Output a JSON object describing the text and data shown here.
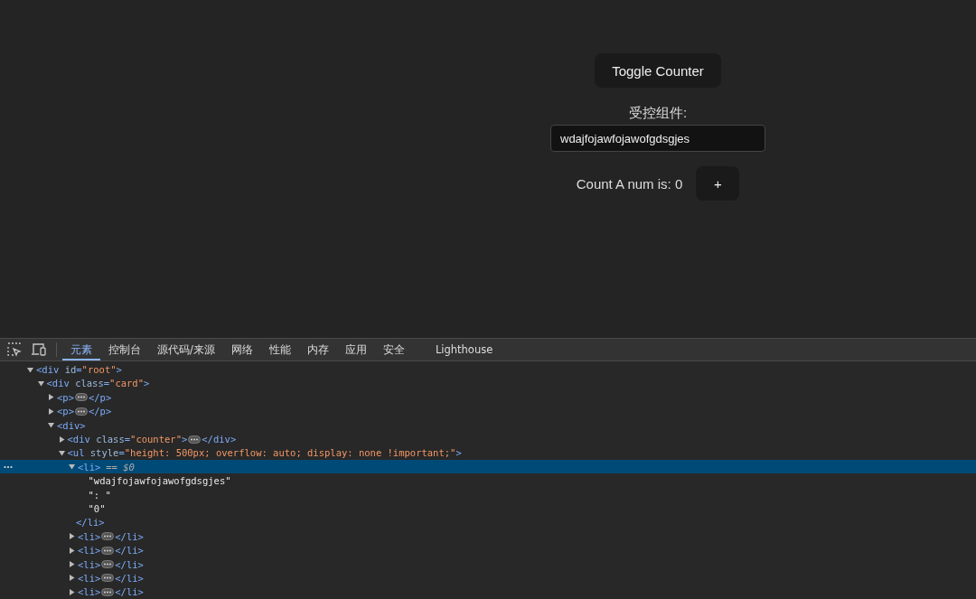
{
  "page": {
    "toggle_button": "Toggle Counter",
    "field_label": "受控组件:",
    "field_value": "wdajfojawfojawofgdsgjes",
    "counter_text": "Count A num is: 0",
    "increment_button": "+"
  },
  "devtools": {
    "tabs": [
      {
        "label": "元素",
        "selected": true
      },
      {
        "label": "控制台",
        "selected": false
      },
      {
        "label": "源代码/来源",
        "selected": false
      },
      {
        "label": "网络",
        "selected": false
      },
      {
        "label": "性能",
        "selected": false
      },
      {
        "label": "内存",
        "selected": false
      },
      {
        "label": "应用",
        "selected": false
      },
      {
        "label": "安全",
        "selected": false
      },
      {
        "label": "Lighthouse",
        "selected": false
      }
    ],
    "tree": [
      {
        "kind": "element",
        "open": "<div id=\"root\">",
        "expanded": true,
        "selected": false,
        "children": [
          {
            "kind": "element",
            "open": "<div class=\"card\">",
            "expanded": true,
            "selected": false,
            "children": [
              {
                "kind": "element",
                "open": "<p>",
                "close": "</p>",
                "expanded": false,
                "selected": false
              },
              {
                "kind": "element",
                "open": "<p>",
                "close": "</p>",
                "expanded": false,
                "selected": false
              },
              {
                "kind": "element",
                "open": "<div>",
                "expanded": true,
                "selected": false,
                "children": [
                  {
                    "kind": "element",
                    "open": "<div class=\"counter\">",
                    "close": "</div>",
                    "expanded": false,
                    "selected": false
                  },
                  {
                    "kind": "element",
                    "open": "<ul style=\"height: 500px; overflow: auto; display: none !important;\">",
                    "expanded": true,
                    "selected": false,
                    "children": [
                      {
                        "kind": "element",
                        "open": "<li>",
                        "suffix": "== $0",
                        "close": "</li>",
                        "expanded": true,
                        "selected": true,
                        "children": [
                          {
                            "kind": "text",
                            "text": "\"wdajfojawfojawofgdsgjes\""
                          },
                          {
                            "kind": "text",
                            "text": "\": \""
                          },
                          {
                            "kind": "text",
                            "text": "\"0\""
                          }
                        ]
                      },
                      {
                        "kind": "element",
                        "open": "<li>",
                        "close": "</li>",
                        "expanded": false,
                        "selected": false
                      },
                      {
                        "kind": "element",
                        "open": "<li>",
                        "close": "</li>",
                        "expanded": false,
                        "selected": false
                      },
                      {
                        "kind": "element",
                        "open": "<li>",
                        "close": "</li>",
                        "expanded": false,
                        "selected": false
                      },
                      {
                        "kind": "element",
                        "open": "<li>",
                        "close": "</li>",
                        "expanded": false,
                        "selected": false
                      },
                      {
                        "kind": "element",
                        "open": "<li>",
                        "close": "</li>",
                        "expanded": false,
                        "selected": false
                      }
                    ]
                  }
                ]
              }
            ]
          }
        ]
      }
    ]
  }
}
